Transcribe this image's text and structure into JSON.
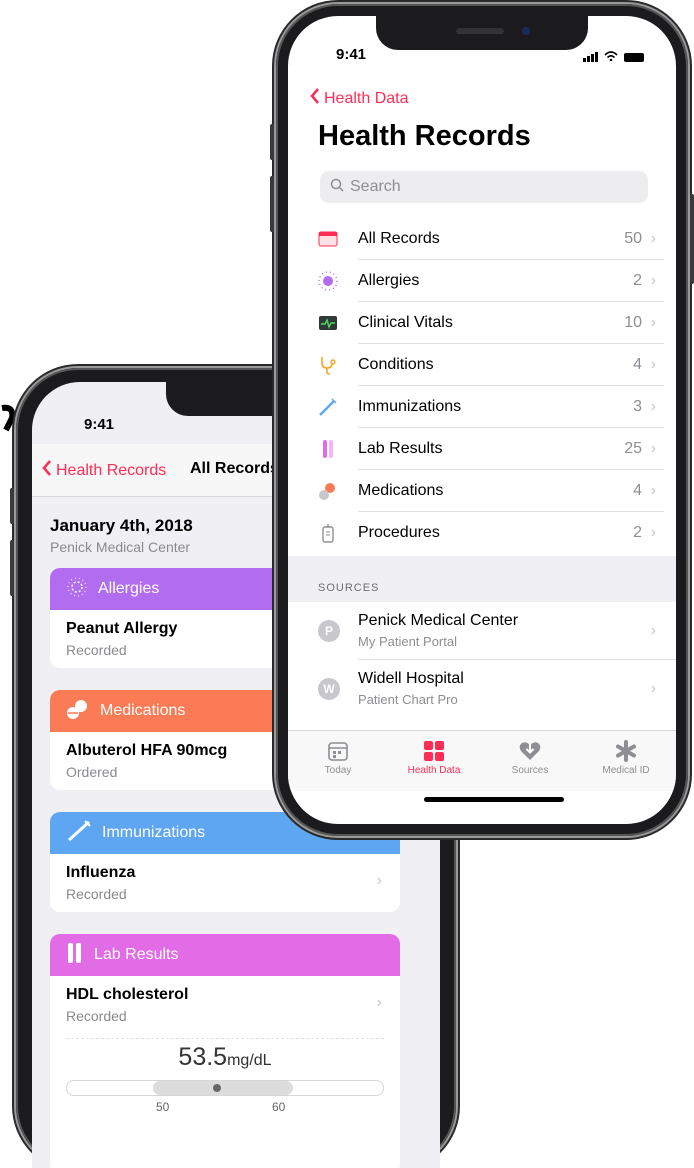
{
  "back_phone": {
    "time": "9:41",
    "nav": {
      "back_label": "Health Records",
      "title": "All Records"
    },
    "date": "January 4th, 2018",
    "source": "Penick Medical Center",
    "cards": [
      {
        "category": "Allergies",
        "color": "#b26cf0",
        "title": "Peanut Allergy",
        "status": "Recorded"
      },
      {
        "category": "Medications",
        "color": "#fa7b55",
        "title": "Albuterol HFA 90mcg",
        "status": "Ordered"
      },
      {
        "category": "Immunizations",
        "color": "#5ea6f2",
        "title": "Influenza",
        "status": "Recorded"
      },
      {
        "category": "Lab Results",
        "color": "#e26be6",
        "title": "HDL cholesterol",
        "status": "Recorded",
        "value": "53.5",
        "unit": "mg/dL",
        "range_low": "50",
        "range_high": "60"
      }
    ]
  },
  "front_phone": {
    "time": "9:41",
    "back_label": "Health Data",
    "title": "Health Records",
    "search_placeholder": "Search",
    "records": [
      {
        "label": "All Records",
        "count": "50",
        "icon": "records-icon"
      },
      {
        "label": "Allergies",
        "count": "2",
        "icon": "allergies-icon"
      },
      {
        "label": "Clinical Vitals",
        "count": "10",
        "icon": "vitals-icon"
      },
      {
        "label": "Conditions",
        "count": "4",
        "icon": "stethoscope-icon"
      },
      {
        "label": "Immunizations",
        "count": "3",
        "icon": "syringe-icon"
      },
      {
        "label": "Lab Results",
        "count": "25",
        "icon": "test-tube-icon"
      },
      {
        "label": "Medications",
        "count": "4",
        "icon": "pills-icon"
      },
      {
        "label": "Procedures",
        "count": "2",
        "icon": "procedures-icon"
      }
    ],
    "sources_header": "SOURCES",
    "sources": [
      {
        "initial": "P",
        "name": "Penick Medical Center",
        "subtitle": "My Patient Portal"
      },
      {
        "initial": "W",
        "name": "Widell Hospital",
        "subtitle": "Patient Chart Pro"
      }
    ],
    "tabs": [
      {
        "label": "Today",
        "icon": "calendar-icon"
      },
      {
        "label": "Health Data",
        "icon": "grid-icon",
        "active": true
      },
      {
        "label": "Sources",
        "icon": "heart-download-icon"
      },
      {
        "label": "Medical ID",
        "icon": "asterisk-icon"
      }
    ]
  },
  "colors": {
    "accent": "#ff2d55",
    "secondary_text": "#8e8e93"
  }
}
